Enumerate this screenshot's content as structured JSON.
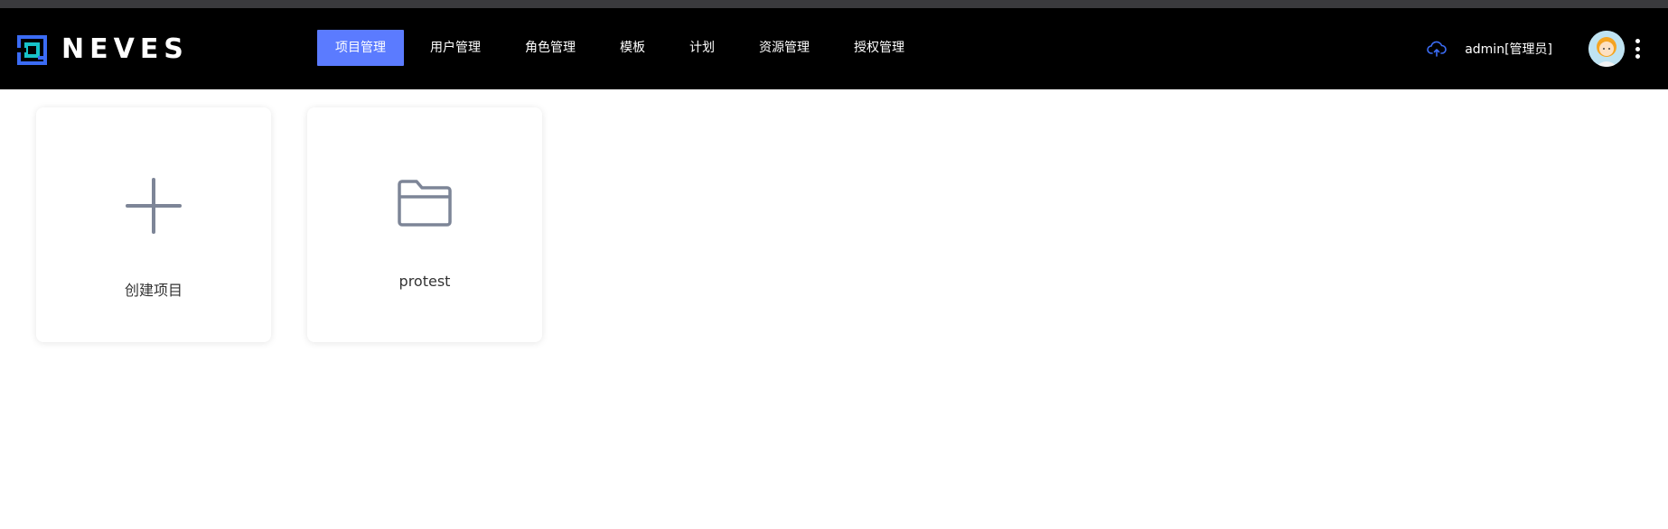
{
  "app": {
    "logo_text": "NEVES"
  },
  "nav": {
    "items": [
      {
        "label": "项目管理",
        "active": true
      },
      {
        "label": "用户管理",
        "active": false
      },
      {
        "label": "角色管理",
        "active": false
      },
      {
        "label": "模板",
        "active": false
      },
      {
        "label": "计划",
        "active": false
      },
      {
        "label": "资源管理",
        "active": false
      },
      {
        "label": "授权管理",
        "active": false
      }
    ]
  },
  "header_right": {
    "cloud_icon": "cloud-upload-icon",
    "user_name": "admin[管理员]",
    "avatar": "avatar",
    "menu_icon": "kebab-menu-icon"
  },
  "cards": {
    "create": {
      "label": "创建项目",
      "icon": "plus-icon"
    },
    "projects": [
      {
        "label": "protest",
        "icon": "folder-icon"
      }
    ]
  },
  "colors": {
    "navbar_bg": "#000000",
    "active_tab": "#5b7bff",
    "icon_gray": "#7d8597",
    "logo_blue": "#3b6cf5",
    "logo_teal": "#17c3c9"
  }
}
